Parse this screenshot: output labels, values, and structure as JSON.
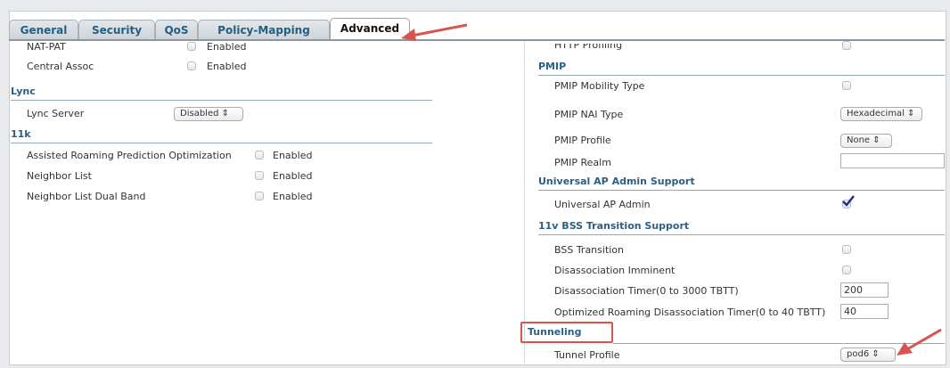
{
  "tabs": [
    {
      "label": "General"
    },
    {
      "label": "Security"
    },
    {
      "label": "QoS"
    },
    {
      "label": "Policy-Mapping"
    },
    {
      "label": "Advanced"
    }
  ],
  "left": {
    "nat_pat": {
      "label": "NAT-PAT",
      "value": "Enabled"
    },
    "central_assoc": {
      "label": "Central Assoc",
      "value": "Enabled"
    },
    "lync_section": "Lync",
    "lync_server": {
      "label": "Lync Server",
      "value": "Disabled"
    },
    "k11_section": "11k",
    "assisted_roaming": {
      "label": "Assisted Roaming Prediction Optimization",
      "value": "Enabled"
    },
    "neighbor_list": {
      "label": "Neighbor List",
      "value": "Enabled"
    },
    "neighbor_list_dual": {
      "label": "Neighbor List Dual Band",
      "value": "Enabled"
    }
  },
  "right": {
    "http_profiling": "HTTP Profiling",
    "pmip_section": "PMIP",
    "pmip_mobility_type": "PMIP Mobility Type",
    "pmip_nai_type": {
      "label": "PMIP NAI Type",
      "value": "Hexadecimal"
    },
    "pmip_profile": {
      "label": "PMIP Profile",
      "value": "None"
    },
    "pmip_realm": "PMIP Realm",
    "uap_section": "Universal AP Admin Support",
    "uap_admin": "Universal AP Admin",
    "bss_section": "11v BSS Transition Support",
    "bss_transition": "BSS Transition",
    "disassoc_imminent": "Disassociation Imminent",
    "disassoc_timer": {
      "label": "Disassociation Timer(0 to 3000 TBTT)",
      "value": "200"
    },
    "opt_roaming_timer": {
      "label": "Optimized Roaming Disassociation Timer(0 to 40 TBTT)",
      "value": "40"
    },
    "tunneling_section": "Tunneling",
    "tunnel_profile": {
      "label": "Tunnel Profile",
      "value": "pod6"
    }
  },
  "colors": {
    "annotation": "#d9534f",
    "section": "#2b5f85"
  }
}
